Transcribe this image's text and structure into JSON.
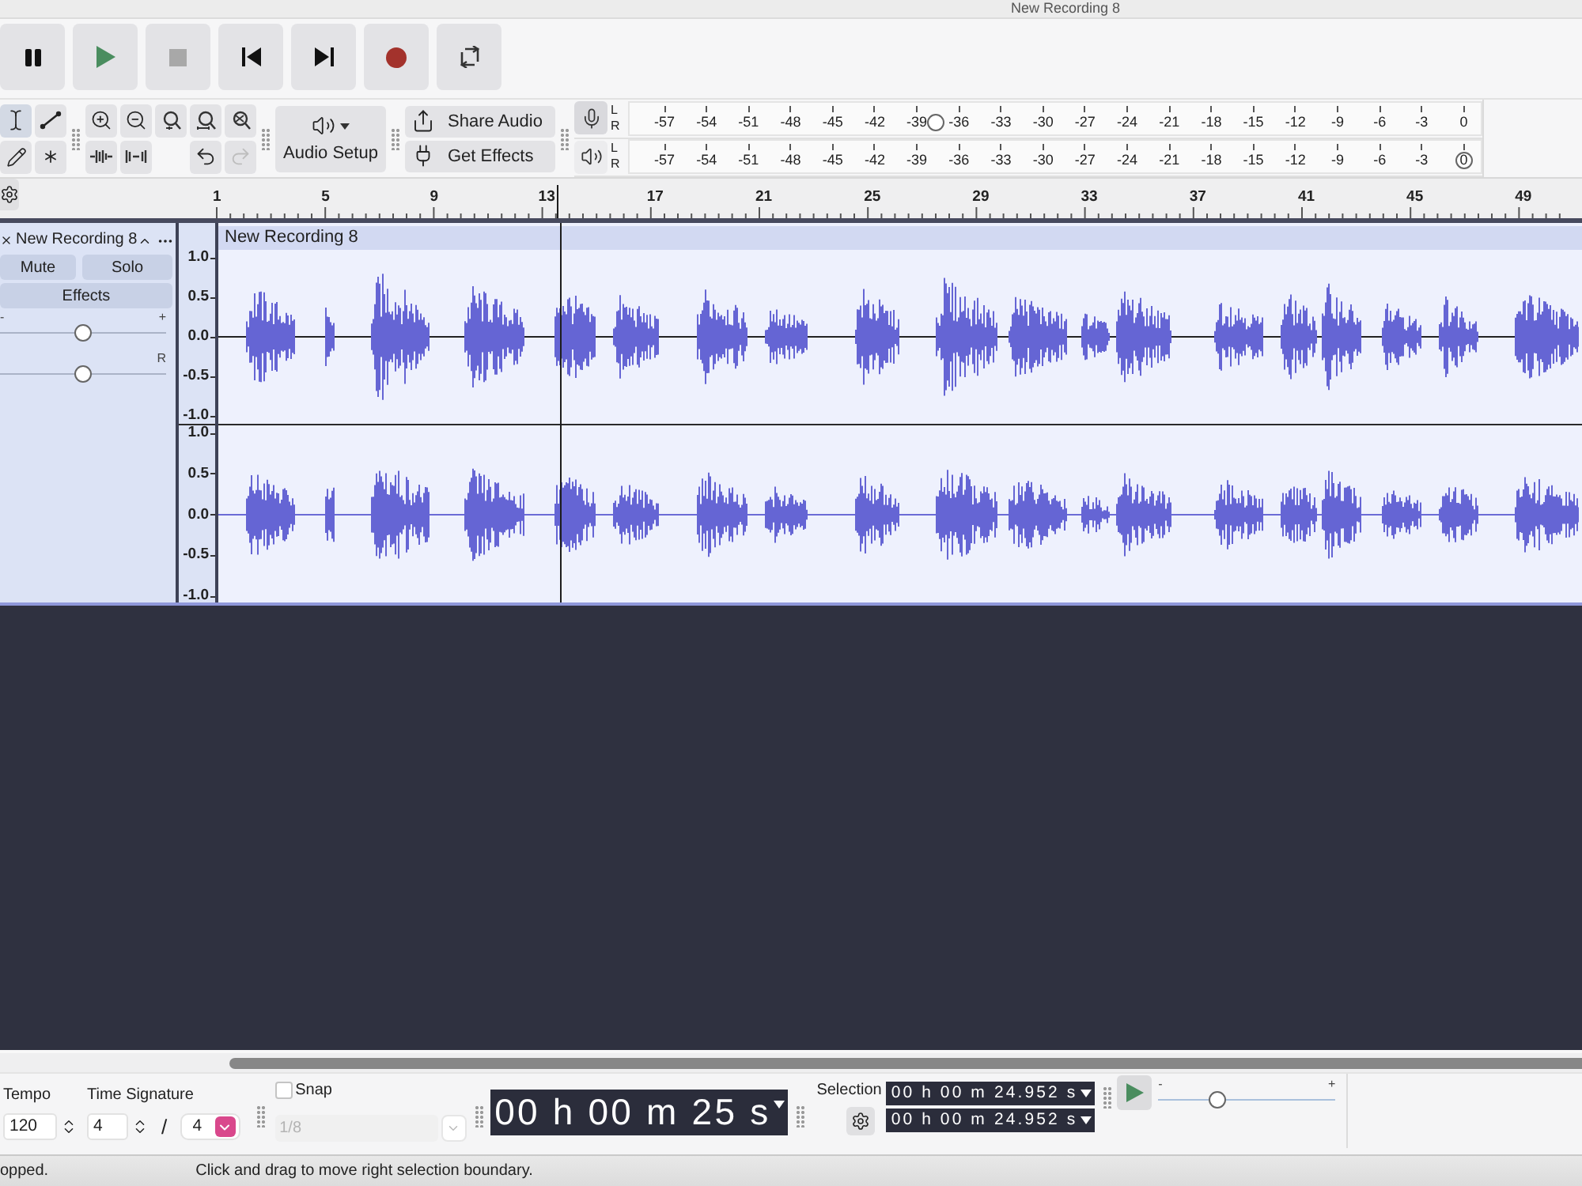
{
  "window": {
    "title": "New Recording 8"
  },
  "tools": [
    {
      "kind": "select",
      "selected": true
    },
    {
      "kind": "envelope",
      "selected": false
    },
    {
      "kind": "draw",
      "selected": false
    },
    {
      "kind": "multi",
      "selected": false
    }
  ],
  "edit": [
    {
      "kind": "undo",
      "disabled": false
    },
    {
      "kind": "redo",
      "disabled": true
    }
  ],
  "audio_setup": "Audio Setup",
  "share": [
    {
      "kind": "share",
      "label": "Share Audio"
    },
    {
      "kind": "effects",
      "label": "Get Effects"
    }
  ],
  "meters": [
    {
      "kind": "record",
      "channels": [
        "L",
        "R"
      ],
      "scale": [
        "-57",
        "-54",
        "-51",
        "-48",
        "-45",
        "-42",
        "-39",
        "-36",
        "-33",
        "-30",
        "-27",
        "-24",
        "-21",
        "-18",
        "-15",
        "-12",
        "-9",
        "-6",
        "-3",
        "0"
      ],
      "level": 0.36
    },
    {
      "kind": "playback",
      "channels": [
        "L",
        "R"
      ],
      "scale": [
        "-57",
        "-54",
        "-51",
        "-48",
        "-45",
        "-42",
        "-39",
        "-36",
        "-33",
        "-30",
        "-27",
        "-24",
        "-21",
        "-18",
        "-15",
        "-12",
        "-9",
        "-6",
        "-3",
        "0"
      ],
      "level": 0.98
    }
  ],
  "ruler": [
    "1",
    "5",
    "9",
    "13",
    "17",
    "21",
    "25",
    "29",
    "33",
    "37",
    "41",
    "45",
    "49"
  ],
  "track": {
    "name": "New Recording 8",
    "buttons": [
      "Mute",
      "Solo"
    ],
    "effects": "Effects",
    "gain": {
      "min": "-",
      "max": "+",
      "level": 0.5
    },
    "pan": {
      "max": "R",
      "level": 0.5
    },
    "clip": {
      "title": "New Recording 8"
    },
    "channels": [
      {
        "scale": [
          "1.0",
          "0.5",
          "0.0",
          "-0.5",
          "-1.0"
        ]
      },
      {
        "scale": [
          "1.0",
          "0.5",
          "0.0",
          "-0.5",
          "-1.0"
        ]
      }
    ]
  },
  "tempo": {
    "label": "Tempo",
    "value": "120"
  },
  "time_signature": {
    "label": "Time Signature",
    "beats": "4",
    "separator": "/",
    "unit": "4"
  },
  "snap": {
    "label": "Snap",
    "checked": false,
    "value": "1/8",
    "disabled": true
  },
  "time": "00 h 00 m 25 s",
  "selection": {
    "label": "Selection",
    "start": "00 h 00 m 24.952 s",
    "end": "00 h 00 m 24.952 s"
  },
  "play_at_speed": {
    "min": "-",
    "max": "+",
    "level": 0.32
  },
  "status_bar": [
    "opped.",
    "Click and drag to move right selection boundary."
  ]
}
